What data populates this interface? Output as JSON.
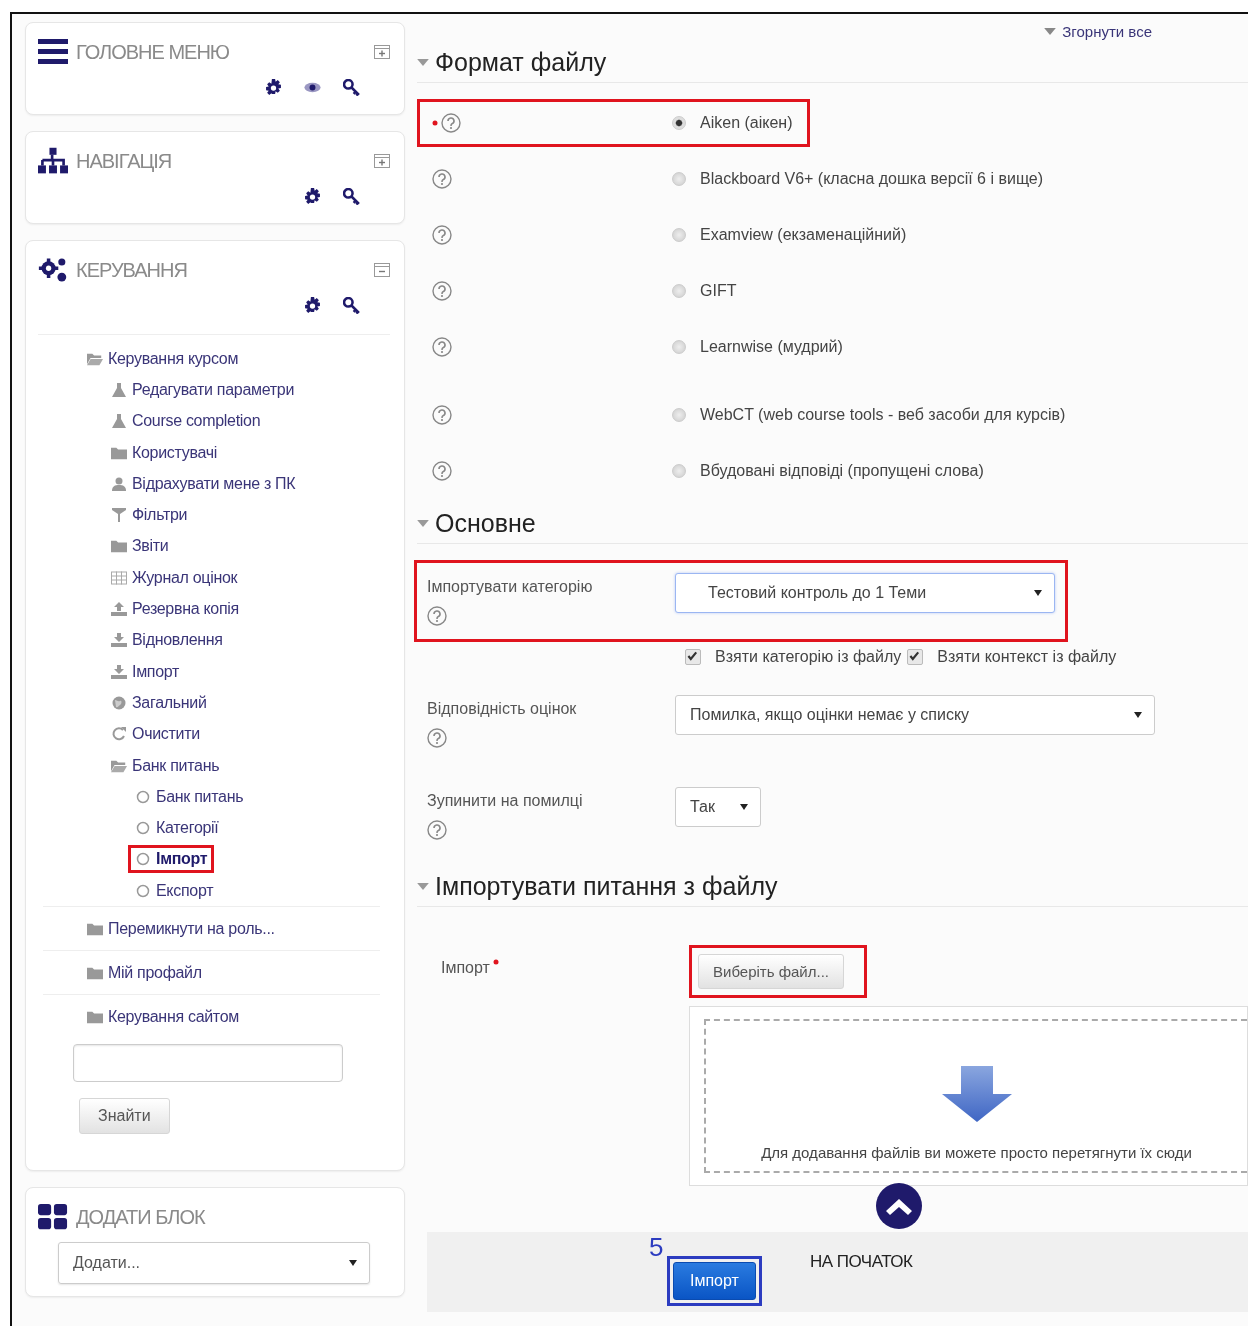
{
  "sidebar": {
    "blocks": [
      {
        "kind": "menu",
        "title": "ГОЛОВНЕ МЕНЮ",
        "collapsed": true
      },
      {
        "kind": "navigation",
        "title": "НАВІГАЦІЯ",
        "collapsed": true
      },
      {
        "kind": "admin",
        "title": "КЕРУВАННЯ",
        "collapsed": false,
        "tree": [
          {
            "label": "Керування курсом",
            "kind": "folder-open",
            "children": [
              {
                "label": "Редагувати параметри",
                "kind": "edit"
              },
              {
                "label": "Course completion",
                "kind": "edit"
              },
              {
                "label": "Користувачі",
                "kind": "folder"
              },
              {
                "label": "Відрахувати мене з ПК",
                "kind": "user"
              },
              {
                "label": "Фільтри",
                "kind": "filter"
              },
              {
                "label": "Звіти",
                "kind": "folder"
              },
              {
                "label": "Журнал оцінок",
                "kind": "table"
              },
              {
                "label": "Резервна копія",
                "kind": "upload"
              },
              {
                "label": "Відновлення",
                "kind": "download"
              },
              {
                "label": "Імпорт",
                "kind": "download"
              },
              {
                "label": "Загальний",
                "kind": "globe"
              },
              {
                "label": "Очистити",
                "kind": "reset"
              },
              {
                "label": "Банк питань",
                "kind": "folder-open",
                "children": [
                  {
                    "label": "Банк питань",
                    "kind": "circle",
                    "current": false,
                    "highlighted": false
                  },
                  {
                    "label": "Категорії",
                    "kind": "circle",
                    "current": false,
                    "highlighted": false
                  },
                  {
                    "label": "Імпорт",
                    "kind": "circle",
                    "current": true,
                    "highlighted": true
                  },
                  {
                    "label": "Експорт",
                    "kind": "circle",
                    "current": false,
                    "highlighted": false
                  }
                ]
              }
            ]
          },
          {
            "label": "Перемикнути на роль...",
            "kind": "folder"
          },
          {
            "label": "Мій профайл",
            "kind": "folder"
          },
          {
            "label": "Керування сайтом",
            "kind": "folder"
          }
        ],
        "search_button": "Знайти"
      },
      {
        "kind": "add",
        "title": "ДОДАТИ БЛОК",
        "select": "Додати..."
      }
    ]
  },
  "main": {
    "collapse_all": "Згорнути все",
    "sections": [
      {
        "kind": "formats",
        "title": "Формат файлу",
        "options": [
          {
            "label": "Aiken (аікен)",
            "selected": true,
            "required": true,
            "highlighted": true
          },
          {
            "label": "Blackboard V6+ (класна дошка версії 6 і вище)",
            "selected": false,
            "required": false,
            "highlighted": false
          },
          {
            "label": "Examview (екзаменаційний)",
            "selected": false,
            "required": false,
            "highlighted": false
          },
          {
            "label": "GIFT",
            "selected": false,
            "required": false,
            "highlighted": false
          },
          {
            "label": "Learnwise (мудрий)",
            "selected": false,
            "required": false,
            "highlighted": false
          },
          {
            "label": "WebCT (web course tools - веб засоби для курсів)",
            "selected": false,
            "required": false,
            "highlighted": false
          },
          {
            "label": "Вбудовані відповіді (пропущені слова)",
            "selected": false,
            "required": false,
            "highlighted": false
          }
        ]
      },
      {
        "kind": "general",
        "title": "Основне",
        "fields": [
          {
            "kind": "select",
            "label": "Імпортувати категорію",
            "value": "Тестовий контроль до 1 Теми",
            "highlighted": true,
            "focused": true,
            "wide": false
          },
          {
            "kind": "checkboxes",
            "items": [
              {
                "label": "Взяти категорію із файлу",
                "checked": true
              },
              {
                "label": "Взяти контекст із файлу",
                "checked": true
              }
            ]
          },
          {
            "kind": "select",
            "label": "Відповідність оцінок",
            "value": "Помилка, якщо оцінки немає у списку",
            "highlighted": false,
            "focused": false,
            "wide": true
          },
          {
            "kind": "select",
            "label": "Зупинити на помилці",
            "value": "Так",
            "highlighted": false,
            "focused": false,
            "wide": false,
            "small": true
          }
        ]
      },
      {
        "kind": "file",
        "title": "Імпортувати питання з файлу",
        "label": "Імпорт",
        "required": true,
        "button": "Виберіть файл...",
        "button_highlighted": true,
        "drop_text": "Для додавання файлів ви можете просто перетягнути їх сюди"
      }
    ],
    "footer": {
      "step": "5",
      "submit": "Імпорт",
      "submit_highlighted": true,
      "back_to_top": "НА ПОЧАТОК"
    }
  }
}
